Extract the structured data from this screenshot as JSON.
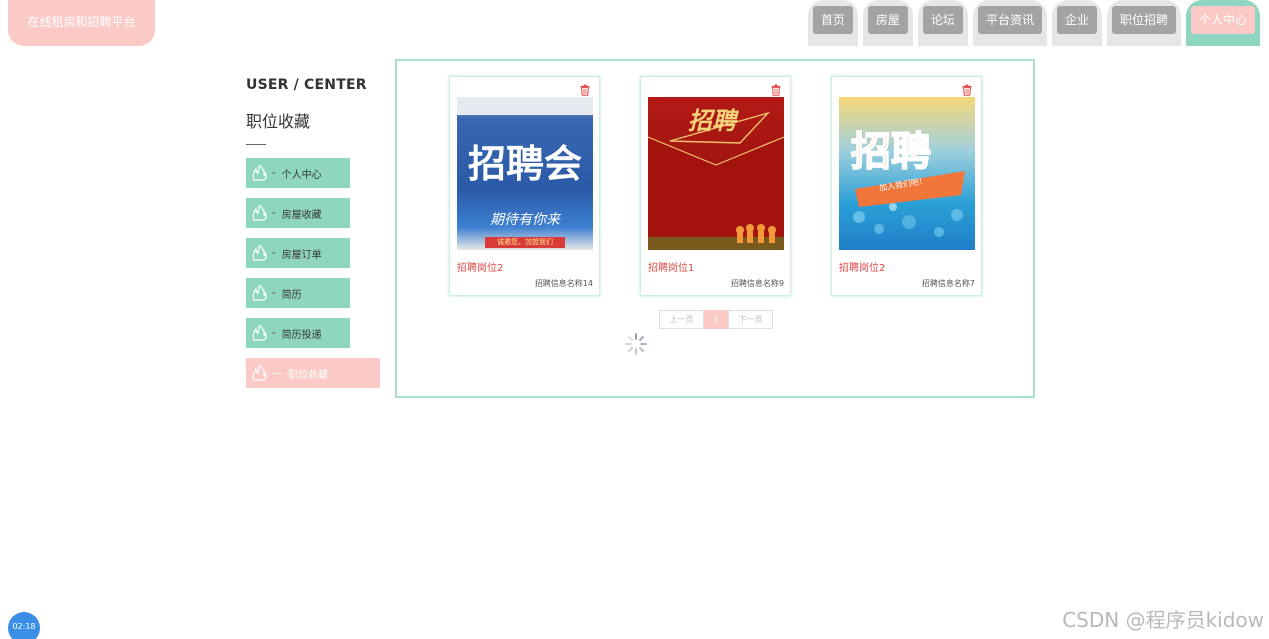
{
  "site": {
    "title": "在线租房和招聘平台"
  },
  "nav": {
    "tabs": [
      {
        "label": "首页"
      },
      {
        "label": "房屋"
      },
      {
        "label": "论坛"
      },
      {
        "label": "平台资讯"
      },
      {
        "label": "企业"
      },
      {
        "label": "职位招聘"
      },
      {
        "label": "个人中心",
        "active": true
      }
    ]
  },
  "sidebar": {
    "title": "USER / CENTER",
    "subtitle": "职位收藏",
    "items": [
      {
        "dash": "-",
        "label": "个人中心"
      },
      {
        "dash": "-",
        "label": "房屋收藏"
      },
      {
        "dash": "-",
        "label": "房屋订单"
      },
      {
        "dash": "-",
        "label": "简历"
      },
      {
        "dash": "-",
        "label": "简历投递"
      },
      {
        "dash": "—",
        "label": "职位收藏",
        "active": true
      }
    ]
  },
  "favorites": [
    {
      "title": "招聘岗位2",
      "subtitle": "招聘信息名称14",
      "poster_text": "招聘会",
      "poster_tagline": "期待有你来",
      "poster_banner": "诚邀您，加盟我们"
    },
    {
      "title": "招聘岗位1",
      "subtitle": "招聘信息名称9",
      "poster_text": "招聘"
    },
    {
      "title": "招聘岗位2",
      "subtitle": "招聘信息名称7",
      "poster_text": "招聘",
      "poster_tagline": "加入我们吧！"
    }
  ],
  "pagination": {
    "prev_label": "上一页",
    "current_page": "1",
    "next_label": "下一页"
  },
  "timer": {
    "label": "02:18"
  },
  "watermark": {
    "text": "CSDN @程序员kidow"
  },
  "colors": {
    "mint": "#8fd6c0",
    "pink": "#fbc9c6",
    "grey_tab": "#a3a3a3",
    "red_text": "#e04848"
  }
}
